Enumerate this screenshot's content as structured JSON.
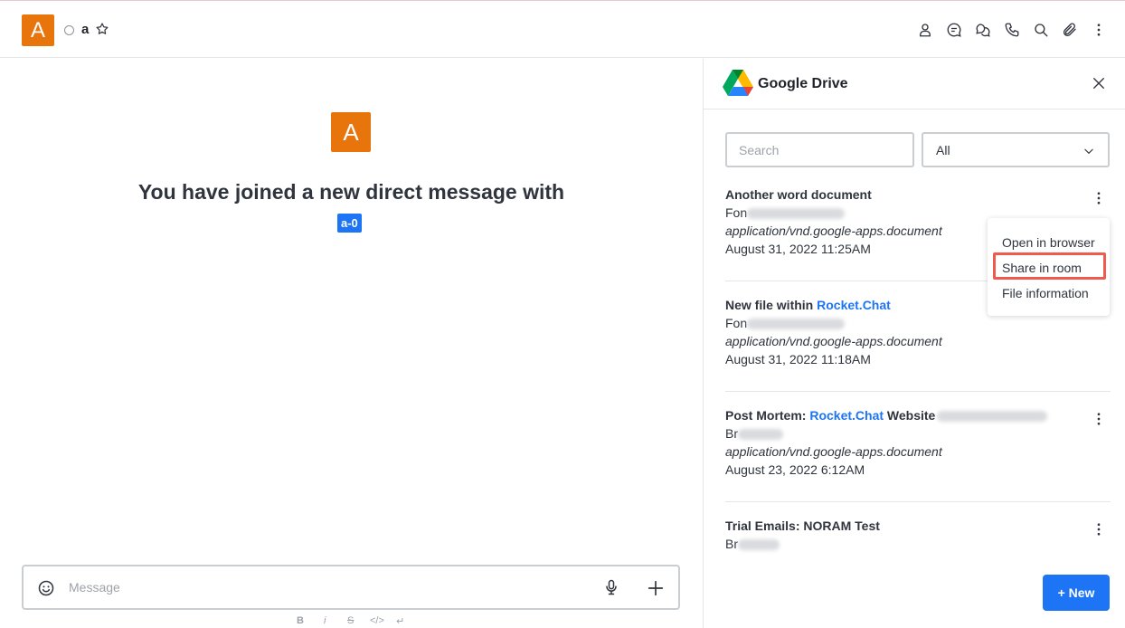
{
  "header": {
    "avatar_letter": "A",
    "room_name": "a",
    "icons": [
      "star-icon",
      "user-info-icon",
      "discussion-icon",
      "threads-icon",
      "call-icon",
      "search-icon",
      "attachment-icon",
      "kebab-menu-icon"
    ]
  },
  "chat": {
    "avatar_letter": "A",
    "joined_text": "You have joined a new direct message with",
    "username": "a-0",
    "composer_placeholder": "Message",
    "format_buttons": [
      "B",
      "i",
      "S",
      "</>",
      "↵"
    ]
  },
  "drive": {
    "title": "Google Drive",
    "search_placeholder": "Search",
    "filter_value": "All",
    "files": [
      {
        "name": "Another word document",
        "name_link": "",
        "name_suffix": "",
        "owner_visible": "Fon",
        "mime": "application/vnd.google-apps.document",
        "date": "August 31, 2022 11:25AM"
      },
      {
        "name": "New file within ",
        "name_link": "Rocket.Chat",
        "name_suffix": "",
        "owner_visible": "Fon",
        "mime": "application/vnd.google-apps.document",
        "date": "August 31, 2022 11:18AM"
      },
      {
        "name": "Post Mortem: ",
        "name_link": "Rocket.Chat",
        "name_suffix": " Website",
        "owner_visible": "Br",
        "mime": "application/vnd.google-apps.document",
        "date": "August 23, 2022 6:12AM"
      },
      {
        "name": "Trial Emails: NORAM Test",
        "name_link": "",
        "name_suffix": "",
        "owner_visible": "Br",
        "mime": "",
        "date": ""
      }
    ],
    "context_menu": {
      "items": [
        "Open in browser",
        "Share in room",
        "File information"
      ],
      "highlighted": "Share in room"
    },
    "new_button": "+ New"
  },
  "colors": {
    "avatar_bg": "#e8740c",
    "primary": "#1d74f5",
    "highlight_border": "#ee5a4e"
  }
}
